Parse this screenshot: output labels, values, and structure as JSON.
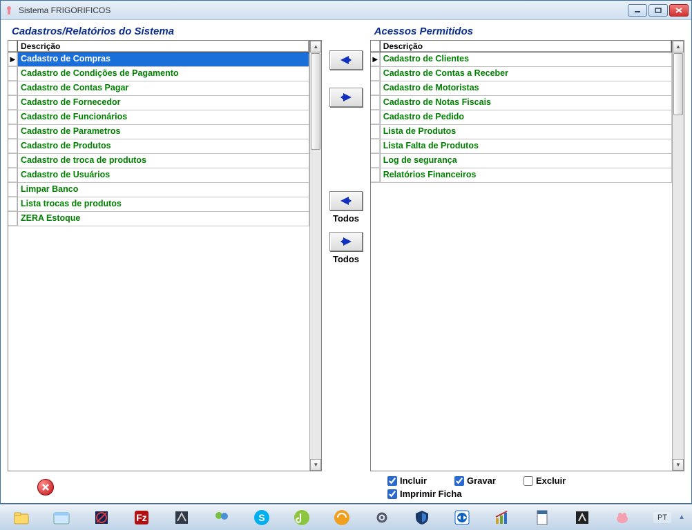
{
  "window": {
    "title": "Sistema FRIGORIFICOS"
  },
  "left_panel": {
    "title": "Cadastros/Relatórios do Sistema",
    "header": "Descrição",
    "selected_index": 0,
    "items": [
      "Cadastro de Compras",
      "Cadastro de Condições de Pagamento",
      "Cadastro de Contas Pagar",
      "Cadastro de Fornecedor",
      "Cadastro de Funcionários",
      "Cadastro de Parametros",
      "Cadastro de Produtos",
      "Cadastro de troca de produtos",
      "Cadastro de Usuários",
      "Limpar Banco",
      "Lista trocas de produtos",
      "ZERA Estoque"
    ]
  },
  "right_panel": {
    "title": "Acessos Permitidos",
    "header": "Descrição",
    "items": [
      "Cadastro de Clientes",
      "Cadastro de Contas a Receber",
      "Cadastro de Motoristas",
      "Cadastro de Notas Fiscais",
      "Cadastro de Pedido",
      "Lista de Produtos",
      "Lista Falta de Produtos",
      "Log de segurança",
      "Relatórios Financeiros"
    ]
  },
  "mid_buttons": {
    "todos_right": "Todos",
    "todos_left": "Todos"
  },
  "checkboxes": {
    "incluir": {
      "label": "Incluir",
      "checked": true
    },
    "gravar": {
      "label": "Gravar",
      "checked": true
    },
    "excluir": {
      "label": "Excluir",
      "checked": false
    },
    "imprimir": {
      "label": "Imprimir Ficha",
      "checked": true
    }
  },
  "tray": {
    "lang": "PT"
  }
}
